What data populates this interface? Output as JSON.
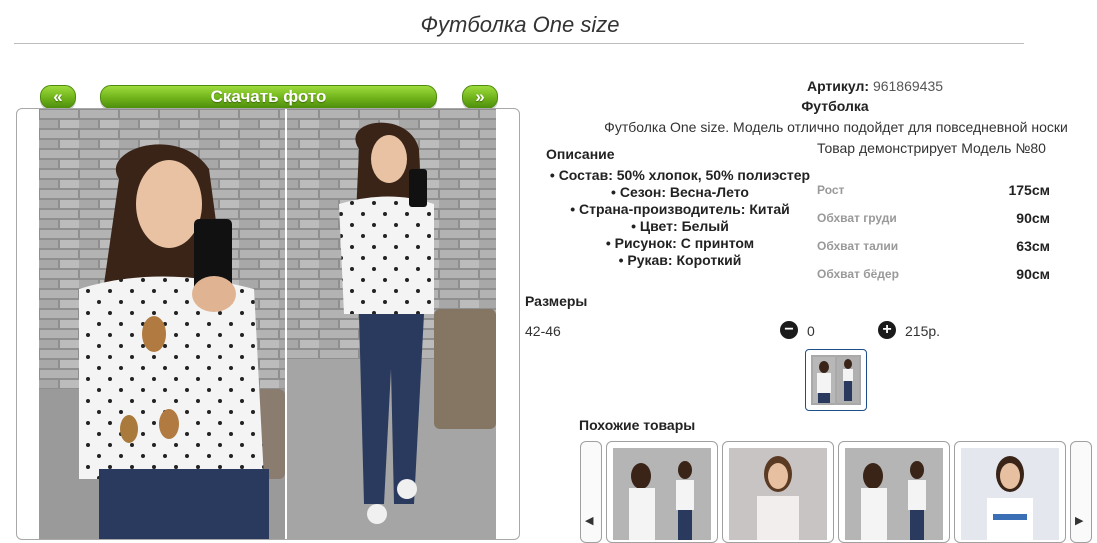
{
  "product": {
    "title": "Футболка One size",
    "sku_label": "Артикул:",
    "sku_value": "961869435",
    "name": "Футболка",
    "description": "Футболка One size. Модель отлично подойдет для повседневной носки",
    "model_note": "Товар демонстрирует Модель №80"
  },
  "photo_nav": {
    "prev_label": "«",
    "download_label": "Скачать фото",
    "next_label": "»"
  },
  "description_section": {
    "heading": "Описание",
    "features": [
      "Состав: 50% хлопок, 50% полиэстер",
      "Сезон: Весна-Лето",
      "Страна-производитель: Китай",
      "Цвет: Белый",
      "Рисунок: С принтом",
      "Рукав: Короткий"
    ]
  },
  "measurements": [
    {
      "label": "Рост",
      "value": "175см"
    },
    {
      "label": "Обхват груди",
      "value": "90см"
    },
    {
      "label": "Обхват талии",
      "value": "63см"
    },
    {
      "label": "Обхват бёдер",
      "value": "90см"
    }
  ],
  "sizes": {
    "heading": "Размеры",
    "range": "42-46",
    "quantity": "0",
    "price": "215р.",
    "minus_icon": "minus-circle-icon",
    "plus_icon": "plus-circle-icon"
  },
  "similar": {
    "heading": "Похожие товары",
    "prev_glyph": "◀",
    "next_glyph": "▶"
  },
  "colors": {
    "button_green": "#6fb21a",
    "thumb_border": "#1f4f8a",
    "brick_wall": "#9a9a9a",
    "jeans": "#2a3a5e"
  }
}
